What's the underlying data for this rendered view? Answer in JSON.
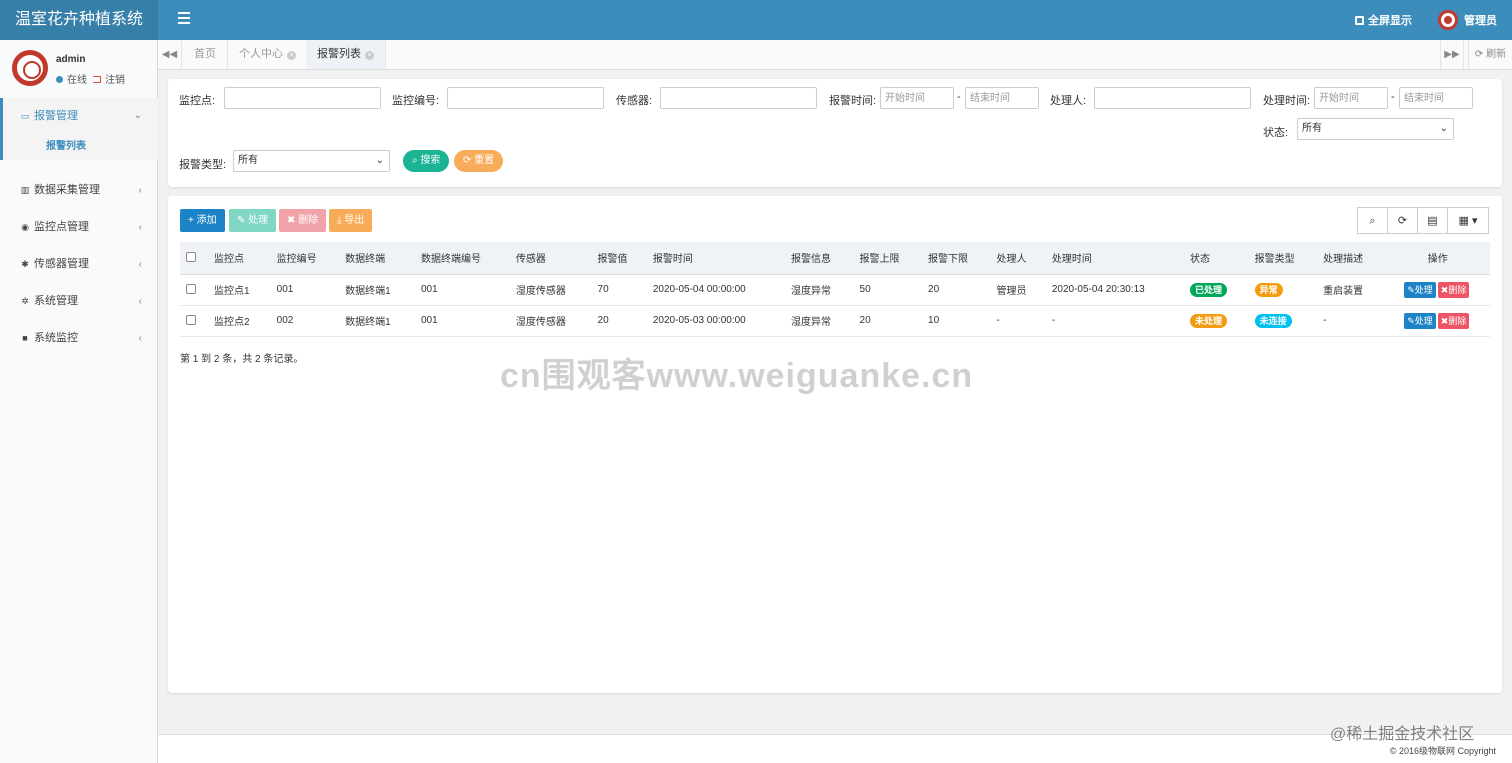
{
  "app": {
    "title": "温室花卉种植系统"
  },
  "header": {
    "fullscreen_label": "全屏显示",
    "user_label": "管理员"
  },
  "sidebar": {
    "user": {
      "name": "admin",
      "online": "在线",
      "logout": "注销"
    },
    "items": [
      {
        "label": "报警管理",
        "icon": "desktop-icon",
        "glyph": "▭",
        "active": true,
        "chevron": "⌄"
      },
      {
        "label": "数据采集管理",
        "icon": "bar-chart-icon",
        "glyph": "▥",
        "active": false,
        "chevron": "‹"
      },
      {
        "label": "监控点管理",
        "icon": "eye-icon",
        "glyph": "◉",
        "active": false,
        "chevron": "‹"
      },
      {
        "label": "传感器管理",
        "icon": "cogs-icon",
        "glyph": "✱",
        "active": false,
        "chevron": "‹"
      },
      {
        "label": "系统管理",
        "icon": "gear-icon",
        "glyph": "✲",
        "active": false,
        "chevron": "‹"
      },
      {
        "label": "系统监控",
        "icon": "video-icon",
        "glyph": "■",
        "active": false,
        "chevron": "‹"
      }
    ],
    "sub_item": "报警列表"
  },
  "tabs": {
    "items": [
      {
        "label": "首页",
        "closable": false
      },
      {
        "label": "个人中心",
        "closable": true
      },
      {
        "label": "报警列表",
        "closable": true,
        "active": true
      }
    ],
    "refresh_label": "刷新"
  },
  "search": {
    "monitor_point_label": "监控点:",
    "monitor_code_label": "监控编号:",
    "sensor_label": "传感器:",
    "alarm_time_label": "报警时间:",
    "start_placeholder": "开始时间",
    "end_placeholder": "结束时间",
    "handler_label": "处理人:",
    "handle_time_label": "处理时间:",
    "status_label": "状态:",
    "status_value": "所有",
    "alarm_type_label": "报警类型:",
    "alarm_type_value": "所有",
    "search_btn": "搜索",
    "reset_btn": "重置"
  },
  "toolbar": {
    "add": "+ 添加",
    "handle": "处理",
    "delete": "删除",
    "export": "导出"
  },
  "table": {
    "headers": [
      "监控点",
      "监控编号",
      "数据终端",
      "数据终端编号",
      "传感器",
      "报警值",
      "报警时间",
      "报警信息",
      "报警上限",
      "报警下限",
      "处理人",
      "处理时间",
      "状态",
      "报警类型",
      "处理描述",
      "操作"
    ],
    "rows": [
      {
        "cells": [
          "监控点1",
          "001",
          "数据终端1",
          "001",
          "湿度传感器",
          "70",
          "2020-05-04 00:00:00",
          "湿度异常",
          "50",
          "20",
          "管理员",
          "2020-05-04 20:30:13"
        ],
        "status": "已处理",
        "status_color": "#00a65a",
        "type": "异常",
        "type_color": "#f39c12",
        "desc": "重启装置"
      },
      {
        "cells": [
          "监控点2",
          "002",
          "数据终端1",
          "001",
          "湿度传感器",
          "20",
          "2020-05-03 00:00:00",
          "湿度异常",
          "20",
          "10",
          "-",
          "-"
        ],
        "status": "未处理",
        "status_color": "#f39c12",
        "type": "未连接",
        "type_color": "#00c0ef",
        "desc": "-"
      }
    ],
    "row_handle": "处理",
    "row_delete": "删除",
    "summary": "第 1 到 2 条，共 2 条记录。"
  },
  "watermark": "cn围观客www.weiguanke.cn",
  "footer": {
    "copyright": "© 2016级物联网 Copyright",
    "juejin": "@稀土掘金技术社区"
  },
  "colors": {
    "primary": "#3c8dbc",
    "success": "#00a65a",
    "warning": "#f39c12",
    "danger": "#dd4b39",
    "info": "#00c0ef"
  }
}
